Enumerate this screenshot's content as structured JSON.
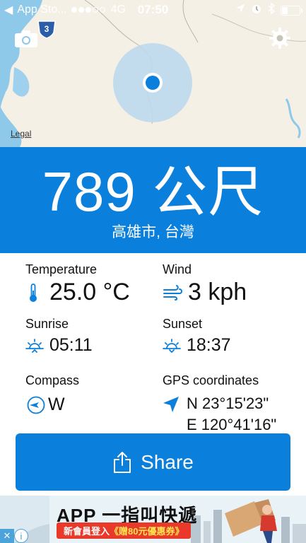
{
  "status_bar": {
    "carrier": "App Sto...",
    "network": "4G",
    "time": "07:50",
    "signal_dots_total": 5,
    "signal_dots_filled": 3,
    "battery_level": 0.35
  },
  "map": {
    "legal_label": "Legal",
    "route_number": "3",
    "colors": {
      "land": "#f5f0e6",
      "water": "#8ec9ea",
      "accuracy": "#bcd9ee",
      "location_dot": "#0a7fdc"
    }
  },
  "altitude": {
    "value": "789 公尺",
    "place": "高雄市, 台灣"
  },
  "info": {
    "temperature": {
      "label": "Temperature",
      "value": "25.0 °C",
      "icon": "thermometer-icon"
    },
    "wind": {
      "label": "Wind",
      "value": "3 kph",
      "icon": "wind-icon"
    },
    "sunrise": {
      "label": "Sunrise",
      "value": "05:11",
      "icon": "sunrise-icon"
    },
    "sunset": {
      "label": "Sunset",
      "value": "18:37",
      "icon": "sunset-icon"
    },
    "compass": {
      "label": "Compass",
      "value": "W",
      "icon": "compass-icon"
    },
    "gps": {
      "label": "GPS coordinates",
      "lat": "N 23°15'23\"",
      "lon": "E 120°41'16\"",
      "icon": "location-arrow-icon"
    }
  },
  "share": {
    "label": "Share",
    "icon": "share-icon"
  },
  "ad": {
    "title": "APP 一指叫快遞",
    "promo_prefix": "新會員登入",
    "promo_highlight": "《贈80元優惠券》",
    "adchoices": [
      "x-icon",
      "info-icon"
    ]
  },
  "accent_color": "#0a7fdc"
}
